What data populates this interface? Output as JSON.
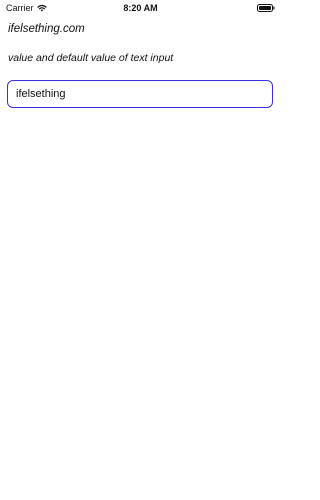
{
  "status_bar": {
    "carrier": "Carrier",
    "time": "8:20 AM",
    "wifi_icon": "wifi-icon",
    "battery_icon": "battery-icon"
  },
  "main": {
    "site_title": "ifelsething.com",
    "subtitle": "value and default value of text input",
    "text_input": {
      "value": "ifelsething"
    }
  },
  "colors": {
    "input_border": "#3a2fe0",
    "text": "#111111",
    "background": "#ffffff"
  }
}
